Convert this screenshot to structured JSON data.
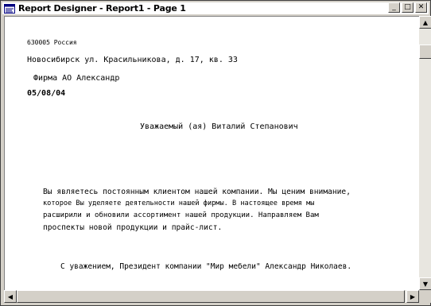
{
  "window": {
    "title": "Report Designer - Report1 - Page 1",
    "icon": "report-designer-icon",
    "buttons": {
      "minimize": "_",
      "maximize": "□",
      "close": "✕"
    }
  },
  "document": {
    "line1": "630005 Россия",
    "line2": "Новосибирск ул. Красильникова, д. 17, кв. 33",
    "line3": "Фирма АО Александр",
    "date": "05/08/04",
    "greeting": "Уважаемый (ая) Виталий Степанович",
    "body1": "Вы являетесь постоянным клиентом нашей компании. Мы ценим внимание,",
    "body2": "которое Вы уделяете деятельности нашей фирмы. В настоящее время мы",
    "body3": "расширили и обновили ассортимент нашей продукции. Направляем Вам",
    "body4": "проспекты новой продукции и прайс-лист.",
    "signature": "С уважением, Президент компании \"Мир мебели\" Александр Николаев."
  },
  "scrollbars": {
    "up": "▲",
    "down": "▼",
    "left": "◀",
    "right": "▶"
  }
}
